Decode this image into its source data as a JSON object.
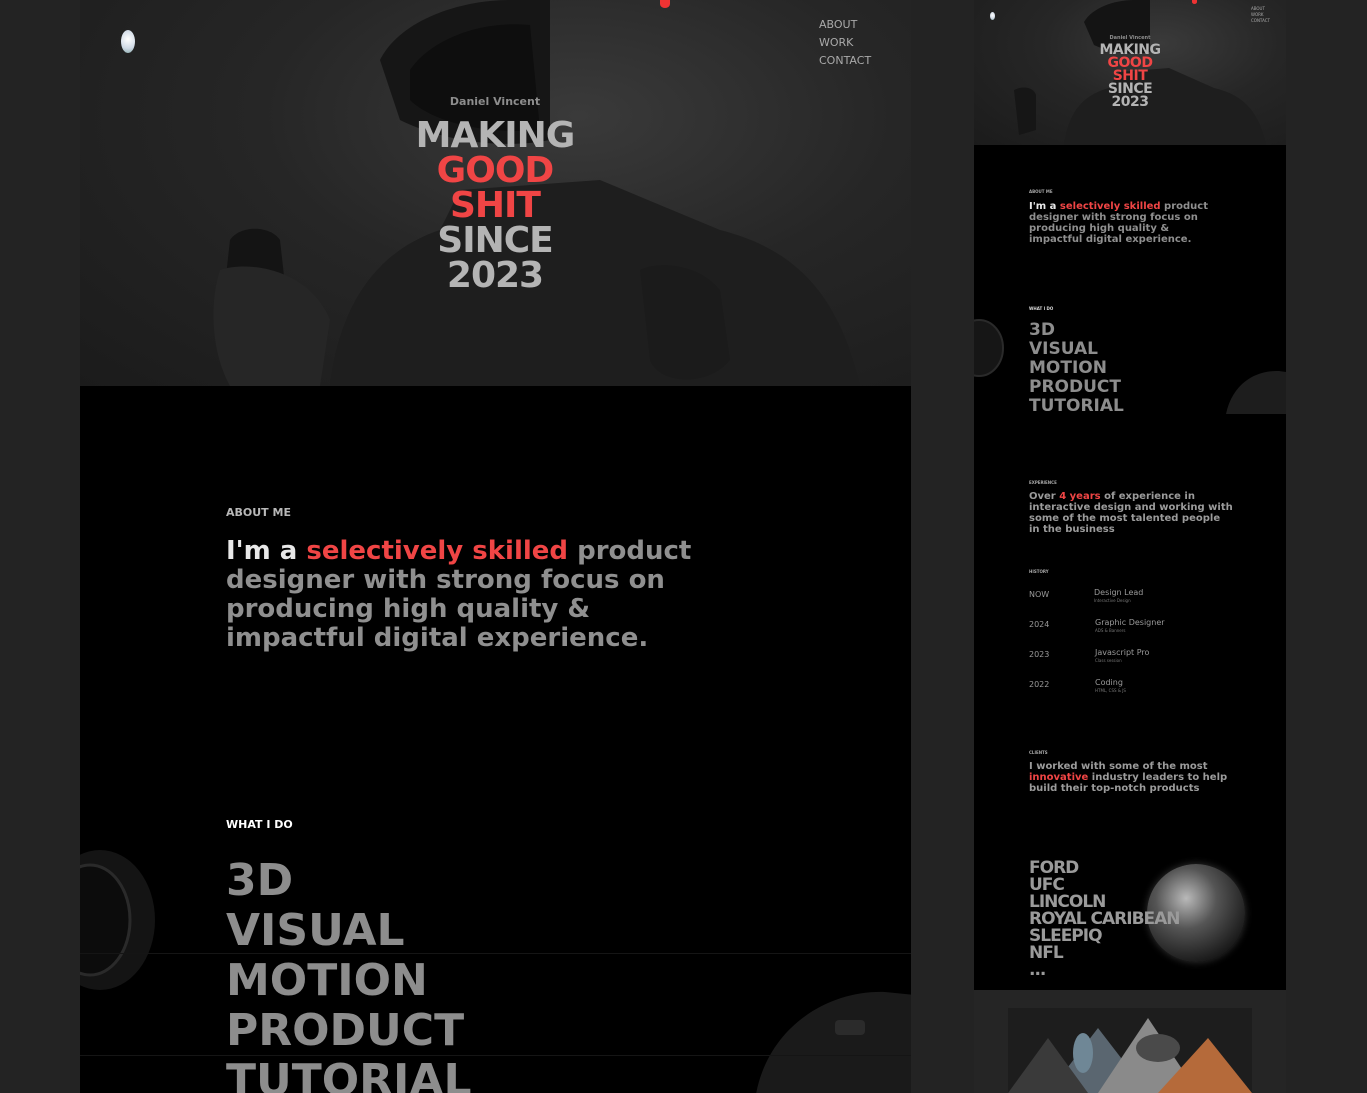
{
  "site": {
    "name": "Daniel Vincent",
    "headline": [
      "MAKING",
      "GOOD",
      "SHIT",
      "SINCE",
      "2023"
    ]
  },
  "nav": [
    "ABOUT",
    "WORK",
    "CONTACT"
  ],
  "about": {
    "label": "ABOUT ME",
    "text_start": "I'm a ",
    "text_highlight": "selectively skilled",
    "text_end": " product designer with strong focus on producing high quality & impactful digital experience."
  },
  "what_i_do": {
    "label": "WHAT I DO",
    "items": [
      "3D",
      "VISUAL",
      "MOTION",
      "PRODUCT",
      "TUTORIAL"
    ]
  },
  "experience": {
    "label": "EXPERIENCE",
    "text_start": "Over ",
    "text_highlight": "4 years",
    "text_end": " of experience in interactive design and working with some of the most talented people in the business"
  },
  "history": {
    "label": "HISTORY",
    "rows": [
      {
        "year": "NOW",
        "title": "Design Lead",
        "sub": "Interactive Design"
      },
      {
        "year": "2024",
        "title": "Graphic Designer",
        "sub": "ADS & Banners"
      },
      {
        "year": "2023",
        "title": "Javascript Pro",
        "sub": "Class session"
      },
      {
        "year": "2022",
        "title": "Coding",
        "sub": "HTML, CSS & JS"
      }
    ]
  },
  "clients": {
    "label": "CLIENTS",
    "text_start": "I worked with some of the most ",
    "text_highlight": "innovative",
    "text_end": " industry leaders to help build their top-notch products",
    "brands": [
      "FORD",
      "UFC",
      "LINCOLN",
      "ROYAL CARIBEAN",
      "SLEEPIQ",
      "NFL",
      "..."
    ]
  },
  "colors": {
    "accent": "#f04545",
    "background": "#000000",
    "page_background": "#232323"
  }
}
